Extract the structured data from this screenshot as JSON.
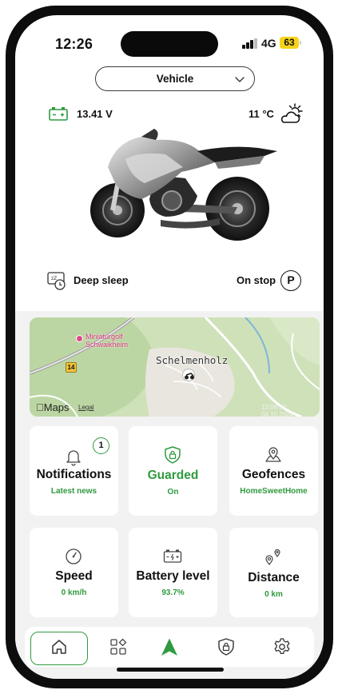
{
  "status_bar": {
    "time": "12:26",
    "network": "4G",
    "battery": "63"
  },
  "vehicle_selector": {
    "label": "Vehicle"
  },
  "vehicle_info": {
    "voltage": "13.41 V",
    "temperature": "11 °C",
    "sleep_state": "Deep sleep",
    "stop_state": "On stop",
    "parking_symbol": "P"
  },
  "map": {
    "place": "Schelmenholz",
    "poi": [
      "Miniaturgolf",
      "Schwaikheim"
    ],
    "road_number": "14",
    "brand": "Maps",
    "legal": "Legal",
    "timestamp": "12:06:50 04.10.2024"
  },
  "cards": [
    {
      "title": "Notifications",
      "subtitle": "Latest news",
      "badge": "1",
      "icon": "bell-icon"
    },
    {
      "title": "Guarded",
      "subtitle": "On",
      "icon": "shield-lock-icon"
    },
    {
      "title": "Geofences",
      "subtitle": "HomeSweetHome",
      "icon": "map-pin-icon"
    },
    {
      "title": "Speed",
      "subtitle": "0 km/h",
      "icon": "speedometer-icon"
    },
    {
      "title": "Battery level",
      "subtitle": "93.7%",
      "icon": "battery-icon"
    },
    {
      "title": "Distance",
      "subtitle": "0 km",
      "icon": "route-icon"
    }
  ],
  "tab_bar": {
    "tabs": [
      "home-icon",
      "apps-icon",
      "navigation-arrow-icon",
      "shield-lock-icon",
      "gear-icon"
    ],
    "active": "home-icon"
  },
  "colors": {
    "accent_green": "#2f9a3e",
    "battery_yellow": "#f6d21a",
    "background_grey": "#f2f2f2"
  }
}
